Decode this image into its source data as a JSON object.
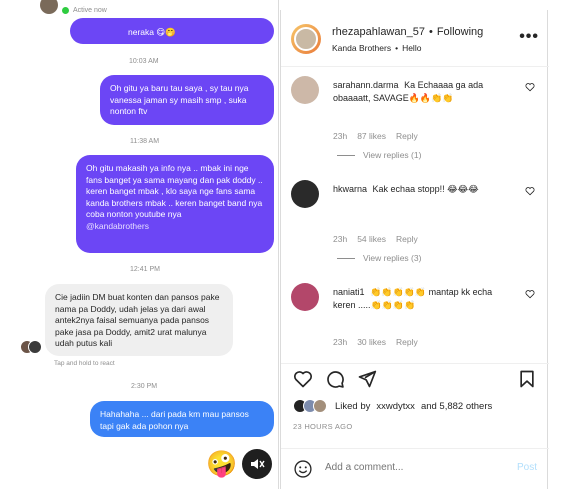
{
  "dm": {
    "active_status": "Active now",
    "messages": [
      {
        "type": "sent",
        "text": "neraka 😋🤭"
      },
      {
        "type": "timestamp",
        "text": "10:03 AM"
      },
      {
        "type": "sent",
        "text": "Oh gitu ya baru tau saya , sy tau nya vanessa jaman sy masih smp , suka nonton ftv"
      },
      {
        "type": "timestamp",
        "text": "11:38 AM"
      },
      {
        "type": "sent",
        "text": "Oh gitu makasih ya info nya .. mbak ini nge fans banget ya sama mayang dan pak doddy .. keren banget mbak , klo saya nge fans sama kanda brothers mbak .. keren banget band nya coba nonton youtube nya",
        "mention": "@kandabrothers"
      },
      {
        "type": "timestamp",
        "text": "12:41 PM"
      },
      {
        "type": "received",
        "text": "Cie jadiin DM buat konten dan pansos pake nama pa Doddy, udah jelas ya dari awal antek2nya faisal semuanya pada pansos pake jasa pa Doddy, amit2 urat malunya udah putus kali"
      },
      {
        "type": "hint",
        "text": "Tap and hold to react"
      },
      {
        "type": "timestamp",
        "text": "2:30 PM"
      },
      {
        "type": "sent",
        "text": "Hahahaha ... dari pada km mau pansos tapi gak ada pohon nya"
      }
    ],
    "emoji_button": "🤪"
  },
  "post": {
    "username": "rhezapahlawan_57",
    "separator": "•",
    "follow_status": "Following",
    "audio_title": "Kanda Brothers",
    "audio_track": "Hello",
    "comments": [
      {
        "user": "sarahann.darma",
        "text": "Ka Echaaaa ga ada obaaaatt, SAVAGE🔥🔥👏👏",
        "time": "23h",
        "likes": "87 likes",
        "reply": "Reply",
        "replies": "View replies (1)",
        "avatar_color": "#cdb8a8"
      },
      {
        "user": "hkwarna",
        "text": "Kak echaa stopp!! 😂😂😂",
        "time": "23h",
        "likes": "54 likes",
        "reply": "Reply",
        "replies": "View replies (3)",
        "avatar_color": "#2a2a2a"
      },
      {
        "user": "naniati1",
        "text": "👏👏👏👏👏 mantap kk echa keren .....👏👏👏👏",
        "time": "23h",
        "likes": "30 likes",
        "reply": "Reply",
        "replies": "",
        "avatar_color": "#b3476a"
      }
    ],
    "liked_by_prefix": "Liked by",
    "liked_by_user": "xxwdytxx",
    "liked_by_suffix": "and 5,882 others",
    "time_ago": "23 HOURS AGO",
    "add_comment_placeholder": "Add a comment...",
    "post_label": "Post"
  }
}
